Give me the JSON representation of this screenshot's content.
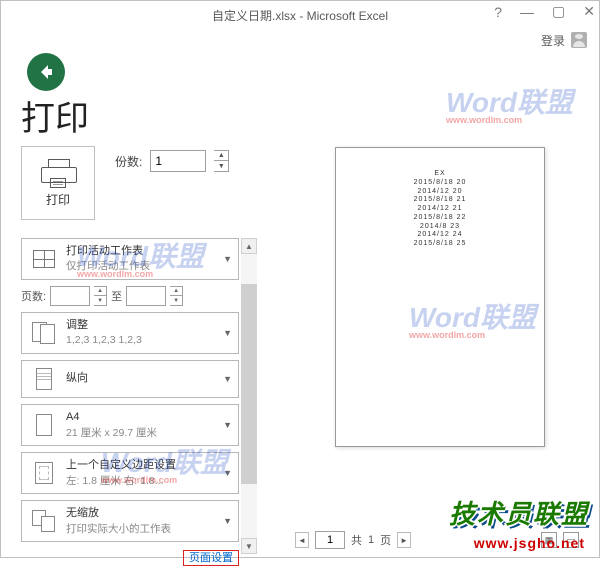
{
  "titlebar": {
    "title": "自定义日期.xlsx - Microsoft Excel",
    "login": "登录"
  },
  "page_heading": "打印",
  "print_tile": {
    "label": "打印"
  },
  "copies": {
    "label": "份数:",
    "value": "1"
  },
  "pages": {
    "label": "页数:",
    "sep": "至",
    "from": "",
    "to": ""
  },
  "settings": {
    "print_area": {
      "main": "打印活动工作表",
      "sub": "仅打印活动工作表"
    },
    "collate": {
      "main": "调整",
      "sub": "1,2,3    1,2,3    1,2,3"
    },
    "orientation": {
      "main": "纵向"
    },
    "paper": {
      "main": "A4",
      "sub": "21 厘米 x 29.7 厘米"
    },
    "margins": {
      "main": "上一个自定义边距设置",
      "sub": "左: 1.8 厘米  右: 1.8..."
    },
    "scaling": {
      "main": "无缩放",
      "sub": "打印实际大小的工作表"
    }
  },
  "page_setup_link": "页面设置",
  "preview_text": [
    "EX",
    "2015/8/18 20",
    "2014/12 20",
    "2015/8/18 21",
    "2014/12 21",
    "2015/8/18 22",
    "2014/8 23",
    "2014/12 24",
    "2015/8/18 25"
  ],
  "pager": {
    "current": "1",
    "total_prefix": "共",
    "total": "1",
    "total_suffix": "页"
  },
  "brand": {
    "text": "技术员联盟",
    "url": "www.jsgho.net"
  },
  "wm": {
    "text": "Word联盟",
    "sub": "www.wordlm.com"
  }
}
